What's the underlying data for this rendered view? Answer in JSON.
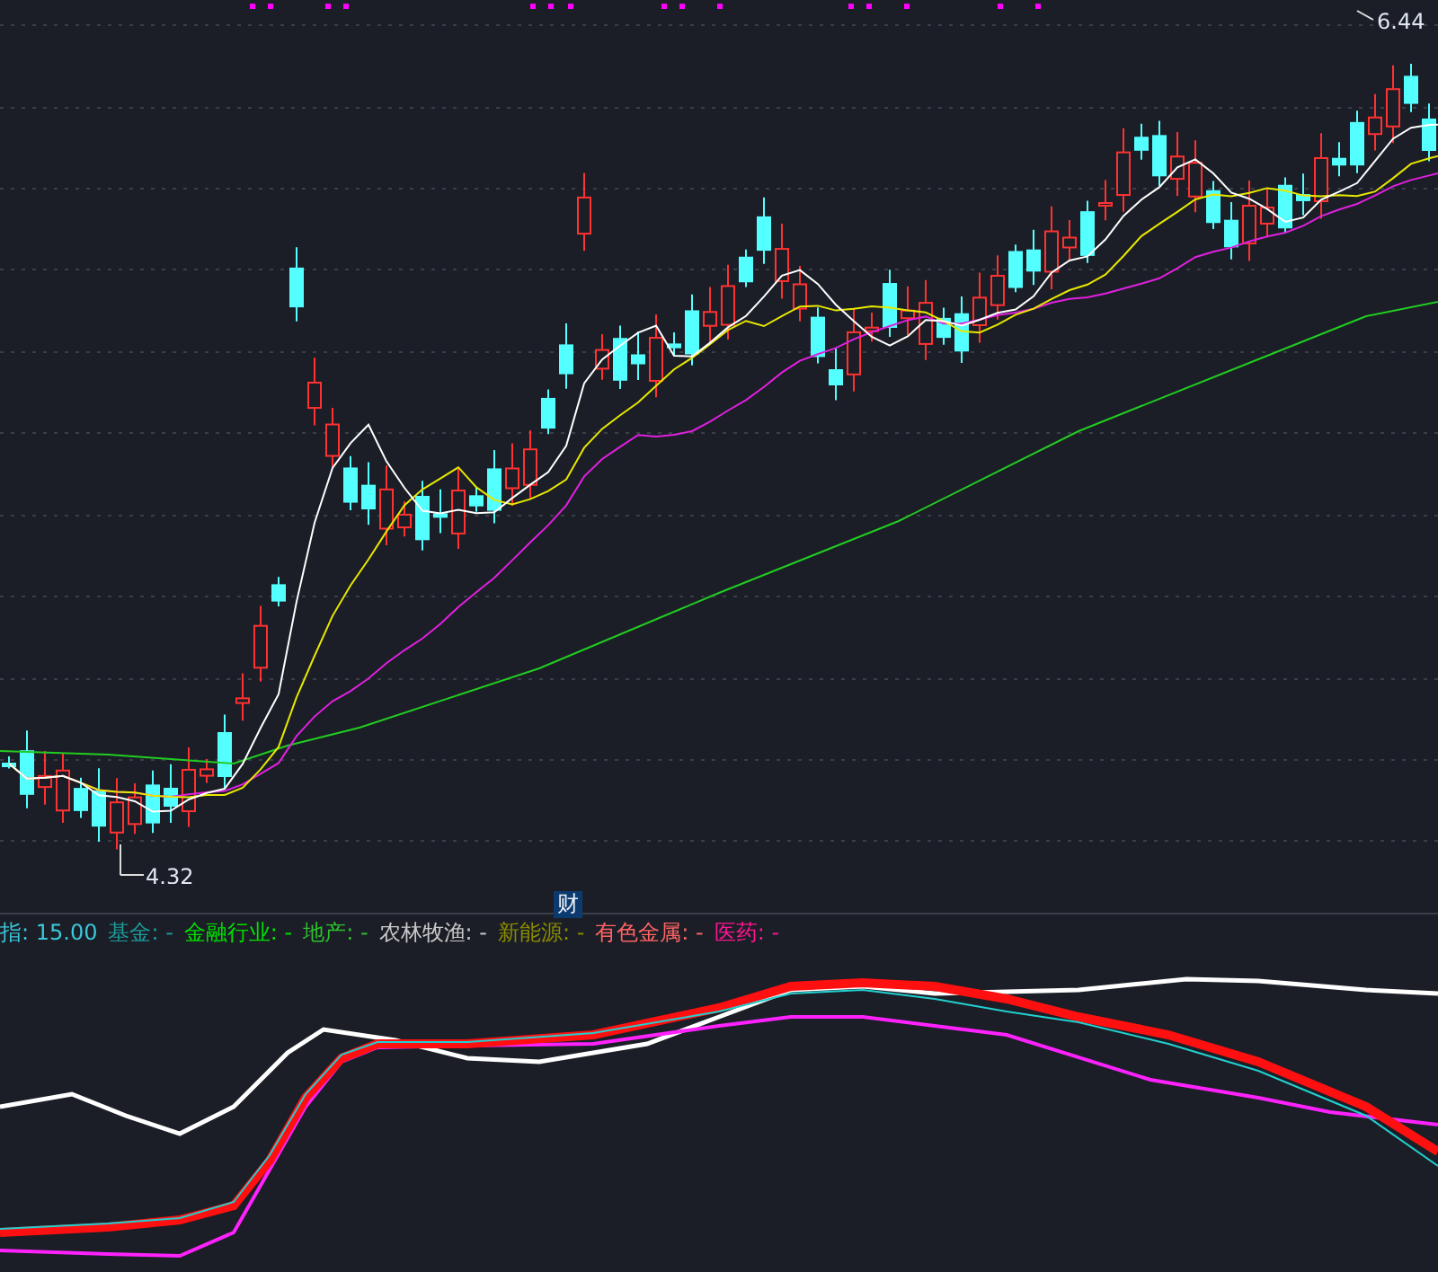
{
  "price_labels": {
    "high": "6.44",
    "low": "4.32"
  },
  "axis_label": "财",
  "legend": [
    {
      "label": "指:",
      "value": "15.00",
      "color": "#39c8dc"
    },
    {
      "label": "基金:",
      "value": "-",
      "color": "#1c9c9c"
    },
    {
      "label": "金融行业:",
      "value": "-",
      "color": "#00e000"
    },
    {
      "label": "地产:",
      "value": "-",
      "color": "#2ec02e"
    },
    {
      "label": "农林牧渔:",
      "value": "-",
      "color": "#c8c8c8"
    },
    {
      "label": "新能源:",
      "value": "-",
      "color": "#8c8c00"
    },
    {
      "label": "有色金属:",
      "value": "-",
      "color": "#ff6464"
    },
    {
      "label": "医药:",
      "value": "-",
      "color": "#ff1493"
    }
  ]
}
